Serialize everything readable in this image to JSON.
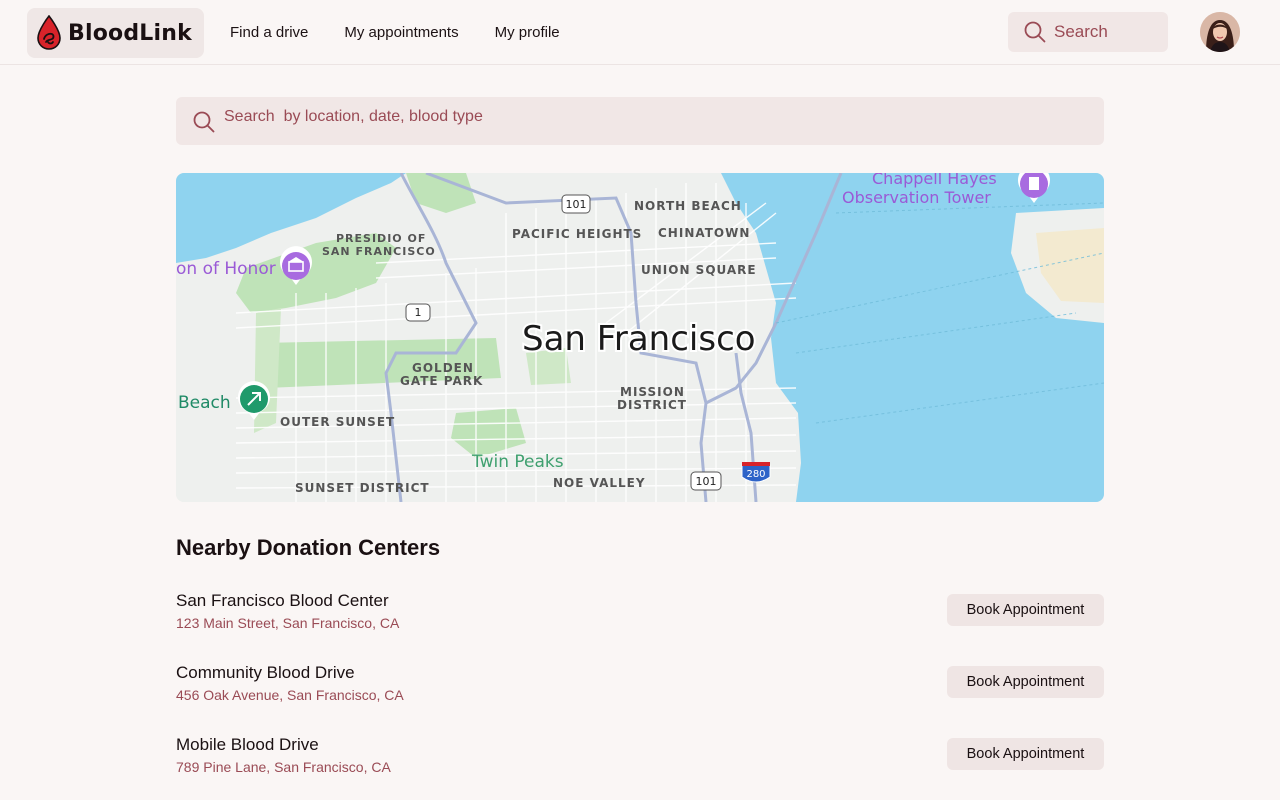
{
  "app": {
    "name": "BloodLink"
  },
  "nav": {
    "items": [
      "Find a drive",
      "My appointments",
      "My profile"
    ]
  },
  "header_search": {
    "placeholder": "Search"
  },
  "main_search": {
    "placeholder": "Search  by location, date, blood type"
  },
  "map": {
    "city_label": "San Francisco",
    "labels": {
      "north_beach": "NORTH BEACH",
      "pacific_heights": "PACIFIC HEIGHTS",
      "chinatown": "CHINATOWN",
      "union_square": "UNION SQUARE",
      "presidio_1": "PRESIDIO OF",
      "presidio_2": "SAN FRANCISCO",
      "legion": "on of Honor",
      "golden_gate_1": "GOLDEN",
      "golden_gate_2": "GATE PARK",
      "mission_1": "MISSION",
      "mission_2": "DISTRICT",
      "beach": "Beach",
      "outer_sunset": "OUTER SUNSET",
      "twin_peaks": "Twin Peaks",
      "sunset_district": "SUNSET DISTRICT",
      "noe_valley": "NOE VALLEY",
      "chappell_1": "Chappell Hayes",
      "chappell_2": "Observation Tower"
    },
    "shields": {
      "r101_top": "101",
      "r101_bottom": "101",
      "r1": "1",
      "r280": "280"
    }
  },
  "section": {
    "title": "Nearby Donation Centers"
  },
  "centers": [
    {
      "name": "San Francisco Blood Center",
      "address": "123 Main Street, San Francisco, CA",
      "button": "Book Appointment"
    },
    {
      "name": "Community Blood Drive",
      "address": "456 Oak Avenue, San Francisco, CA",
      "button": "Book Appointment"
    },
    {
      "name": "Mobile Blood Drive",
      "address": "789 Pine Lane, San Francisco, CA",
      "button": "Book Appointment"
    }
  ],
  "colors": {
    "accent": "#9a4b55",
    "brand_red": "#d8232a",
    "background": "#faf6f5",
    "input_bg": "#f1e7e6",
    "water": "#8fd3ef",
    "park": "#bfe3b8"
  }
}
